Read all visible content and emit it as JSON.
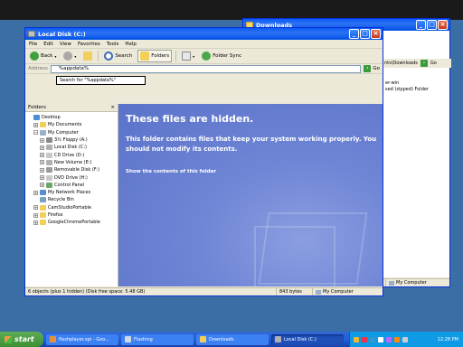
{
  "downloads_window": {
    "title": "Downloads",
    "address_value": "nts\\Downloads",
    "go_label": "Go",
    "file_lines": [
      "er-win",
      "sed (zipped) Folder"
    ],
    "status_text": "My Computer"
  },
  "main_window": {
    "title": "Local Disk (C:)",
    "menu": [
      "File",
      "Edit",
      "View",
      "Favorites",
      "Tools",
      "Help"
    ],
    "toolbar": {
      "back_label": "Back",
      "search_label": "Search",
      "folders_label": "Folders",
      "folder_sync_label": "Folder Sync"
    },
    "address": {
      "label": "Address",
      "value": "%appdata%",
      "go_label": "Go",
      "autocomplete": "Search for \"%appdata%\""
    },
    "folders_pane": {
      "header": "Folders",
      "close": "×",
      "items": [
        {
          "label": "Desktop",
          "indent": 0,
          "exp": "",
          "icon_color": "#4a8ed8"
        },
        {
          "label": "My Documents",
          "indent": 1,
          "exp": "+",
          "icon_color": "#f2cf5b"
        },
        {
          "label": "My Computer",
          "indent": 1,
          "exp": "−",
          "icon_color": "#9ab0c8"
        },
        {
          "label": "3½ Floppy (A:)",
          "indent": 2,
          "exp": "+",
          "icon_color": "#8a8a8a"
        },
        {
          "label": "Local Disk (C:)",
          "indent": 2,
          "exp": "+",
          "icon_color": "#b0b0b0"
        },
        {
          "label": "CD Drive (D:)",
          "indent": 2,
          "exp": "+",
          "icon_color": "#c8c8c8"
        },
        {
          "label": "New Volume (E:)",
          "indent": 2,
          "exp": "+",
          "icon_color": "#b0b0b0"
        },
        {
          "label": "Removable Disk (F:)",
          "indent": 2,
          "exp": "+",
          "icon_color": "#9a9a9a"
        },
        {
          "label": "DVD Drive (H:)",
          "indent": 2,
          "exp": "+",
          "icon_color": "#c8c8c8"
        },
        {
          "label": "Control Panel",
          "indent": 2,
          "exp": "+",
          "icon_color": "#6aa86a"
        },
        {
          "label": "My Network Places",
          "indent": 1,
          "exp": "+",
          "icon_color": "#5a8ad0"
        },
        {
          "label": "Recycle Bin",
          "indent": 1,
          "exp": "",
          "icon_color": "#7aa0c0"
        },
        {
          "label": "CamStudioPortable",
          "indent": 1,
          "exp": "+",
          "icon_color": "#f2cf5b"
        },
        {
          "label": "Firefox",
          "indent": 1,
          "exp": "+",
          "icon_color": "#f2cf5b"
        },
        {
          "label": "GoogleChromePortable",
          "indent": 1,
          "exp": "+",
          "icon_color": "#f2cf5b"
        }
      ]
    },
    "hidden_notice": {
      "title": "These files are hidden.",
      "description": "This folder contains files that keep your system working properly. You should not modify its contents.",
      "link": "Show the contents of this folder"
    },
    "status": {
      "objects": "6 objects (plus 1 hidden) (Disk free space: 5.48 GB)",
      "size": "843 bytes",
      "location": "My Computer"
    }
  },
  "taskbar": {
    "start_label": "start",
    "tasks": [
      {
        "label": "flashplayer.xpi - Goo...",
        "active": false,
        "icon_color": "#e8913a"
      },
      {
        "label": "Flashing",
        "active": false,
        "icon_color": "#cfd9e6"
      },
      {
        "label": "Downloads",
        "active": false,
        "icon_color": "#f2cf5b"
      },
      {
        "label": "Local Disk (C:)",
        "active": true,
        "icon_color": "#b0b0b0"
      }
    ],
    "clock": "12:28 PM"
  }
}
